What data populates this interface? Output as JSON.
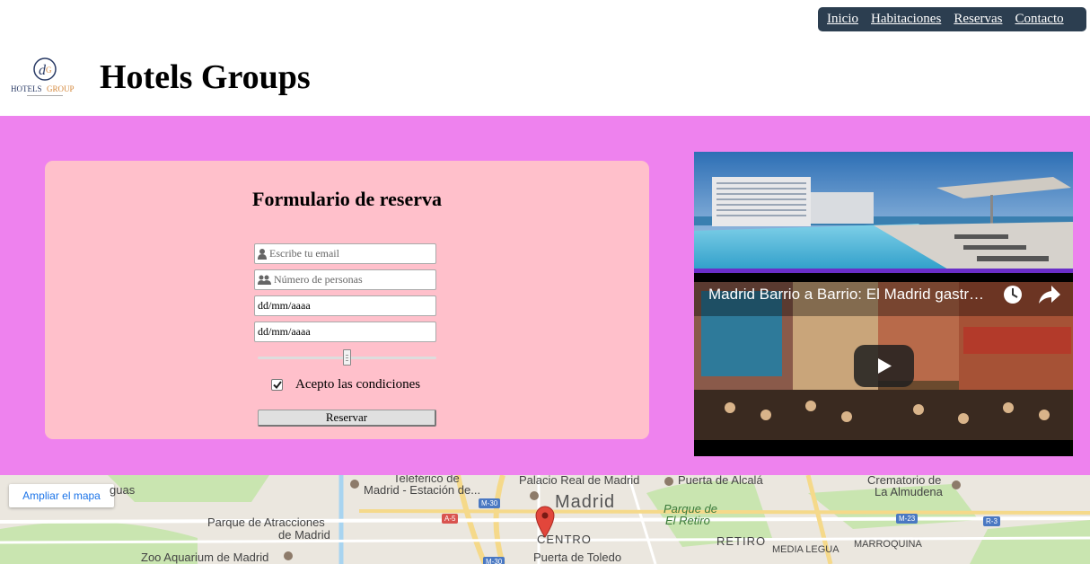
{
  "nav": {
    "items": [
      "Inicio",
      "Habitaciones",
      "Reservas",
      "Contacto"
    ]
  },
  "header": {
    "title": "Hotels Groups",
    "logo_text": "HOTELS GROUP"
  },
  "form": {
    "title": "Formulario de reserva",
    "email_placeholder": "Escribe tu email",
    "people_placeholder": "Número de personas",
    "date_in": "dd/mm/aaaa",
    "date_out": "dd/mm/aaaa",
    "slider_value_percent": 50,
    "accept_label": "Acepto las condiciones",
    "accept_checked": true,
    "submit_label": "Reservar"
  },
  "video": {
    "title": "Madrid Barrio a Barrio: El Madrid gastr…"
  },
  "map": {
    "expand_label": "Ampliar el mapa",
    "labels": {
      "teleferico": "Teleférico de",
      "madrid_estacion": "Madrid - Estación de...",
      "palacio": "Palacio Real de Madrid",
      "madrid": "Madrid",
      "puerta_alcala": "Puerta de Alcalá",
      "crematorio": "Crematorio de",
      "almudena": "La Almudena",
      "guas": "guas",
      "parque_atracciones": "Parque de Atracciones",
      "de_madrid": "de Madrid",
      "parque_retiro_1": "Parque de",
      "parque_retiro_2": "El Retiro",
      "centro": "CENTRO",
      "retiro": "RETIRO",
      "zoo": "Zoo Aquarium de Madrid",
      "puerta_toledo": "Puerta de Toledo",
      "media_legua": "MEDIA LEGUA",
      "marroquina": "MARROQUINA"
    },
    "roads": [
      "M-30",
      "A-5",
      "M-30",
      "M-23",
      "R-3",
      "M-30"
    ]
  },
  "colors": {
    "nav_bg": "#2c3e50",
    "band": "#ee82ee",
    "card": "#ffc0cb"
  }
}
